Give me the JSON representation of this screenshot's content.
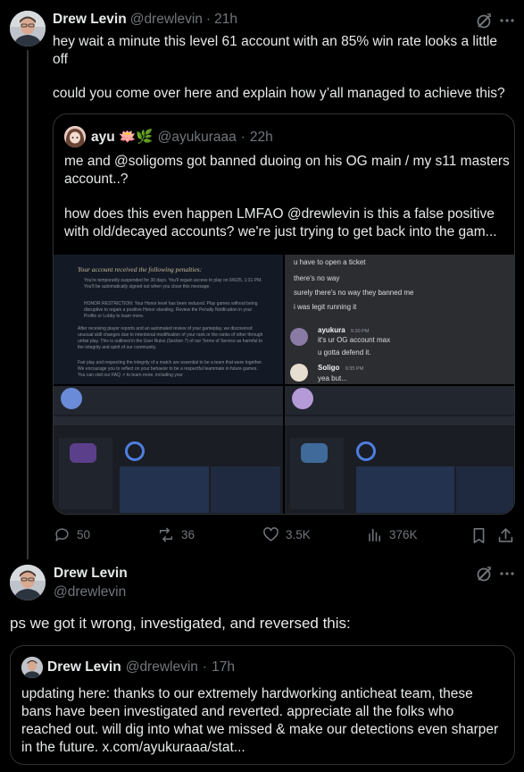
{
  "tweet1": {
    "author_name": "Drew Levin",
    "author_handle": "@drewlevin",
    "separator": "·",
    "time": "21h",
    "text_line1": "hey wait a minute this level 61 account with an 85% win rate looks a little",
    "text_line2": "off",
    "text_line3": "could you come over here and explain how y’all managed to achieve this?",
    "quote": {
      "author_name": "ayu 🪷🌿",
      "author_handle": "@ayukuraaa",
      "separator": "·",
      "time": "22h",
      "text_line1": "me and @soligoms got banned duoing on his OG main / my s11 masters",
      "text_line2": "account..?",
      "text_line3": "how does this even happen LMFAO @drewlevin is this a false positive",
      "text_line4": "with old/decayed accounts? we're just trying to get back into the gam...",
      "media": {
        "penalty_title": "Your account received the following penalties:",
        "penalty_b1": "You're temporarily suspended for 30 days. You'll regain access to play on 9/6/25, 1:31 PM. You'll be automatically signed out when you close this message.",
        "penalty_b2": "HONOR RESTRICTION: Your Honor level has been reduced. Play games without being disruptive to regain a positive Honor standing. Review the Penalty Notification in your Profile or Lobby to learn more.",
        "penalty_p1": "After receiving player reports and an automated review of your gameplay, we discovered unusual skill changes due to intentional modification of your rank or the ranks of other through unfair play. This is outlined in the User Rules (Section 7) of our Terms of Service as harmful to the integrity and spirit of our community.",
        "penalty_p2": "Fair play and respecting the integrity of a match are essential to be a team that were together. We encourage you to reflect on your behavior to be a respectful teammate in future games. You can visit our FAQ ↗ to learn more, including your",
        "chat_top": "u have to open a ticket",
        "chat_l2": "there's no way",
        "chat_l3": "surely there's no way they banned me",
        "chat_l4": "i was legit running it",
        "chat_user1": "ayukura",
        "chat_user1_time": "9:30 PM",
        "chat_user1_l1": "it's ur OG account max",
        "chat_user1_l2": "u gotta defend it.",
        "chat_user2": "Soligo",
        "chat_user2_time": "9:35 PM",
        "chat_user2_l1": "yea but..."
      }
    },
    "stats": {
      "replies": "50",
      "reposts": "36",
      "likes": "3.5K",
      "views": "376K"
    }
  },
  "tweet2": {
    "author_name": "Drew Levin",
    "author_handle": "@drewlevin",
    "text": "ps we got it wrong, investigated, and reversed this:",
    "quote": {
      "author_name": "Drew Levin",
      "author_handle": "@drewlevin",
      "separator": "·",
      "time": "17h",
      "text_line1": "updating here: thanks to our extremely hardworking anticheat team, these",
      "text_line2": "bans have been investigated and reverted. appreciate all the folks who",
      "text_line3": "reached out. will dig into what we missed & make our detections even sharper",
      "text_line4": "in the future. x.com/ayukuraaa/stat..."
    }
  },
  "icons": {
    "grok": "grok-icon",
    "more": "more-icon",
    "reply": "reply-icon",
    "repost": "repost-icon",
    "like": "like-icon",
    "views": "views-icon",
    "bookmark": "bookmark-icon",
    "share": "share-icon"
  },
  "colors": {
    "background": "#000000",
    "text": "#e7e9ea",
    "muted": "#71767b",
    "border": "#2f3336"
  }
}
